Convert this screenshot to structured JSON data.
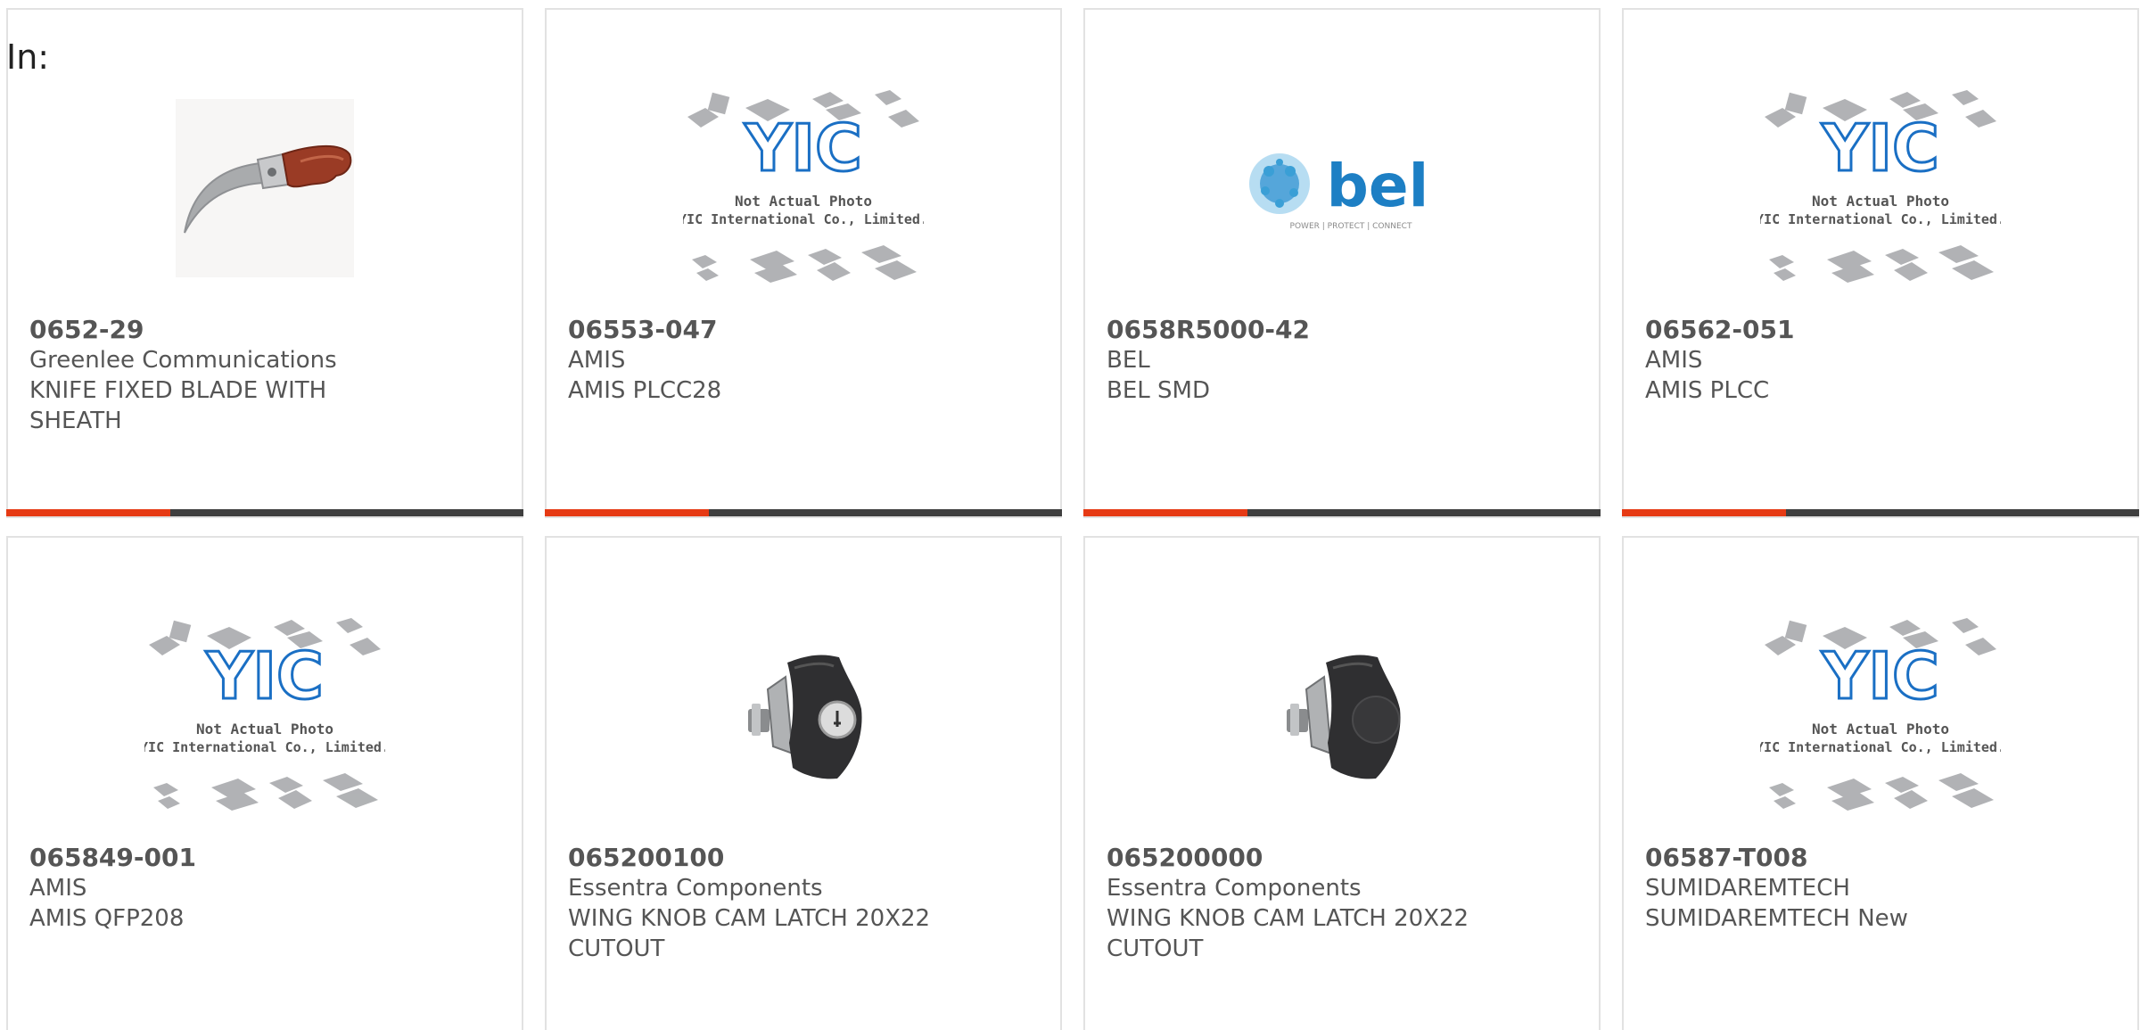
{
  "header": {
    "label": "In:"
  },
  "cards": [
    {
      "part": "0652-29",
      "maker": "Greenlee Communications",
      "description": "KNIFE FIXED BLADE WITH SHEATH",
      "image": "knife-photo",
      "image_text": ""
    },
    {
      "part": "06553-047",
      "maker": "AMIS",
      "description": "AMIS PLCC28",
      "image": "yic-placeholder",
      "image_text": "Not Actual Photo",
      "image_text_2": "YIC International Co., Limited."
    },
    {
      "part": "0658R5000-42",
      "maker": "BEL",
      "description": "BEL SMD",
      "image": "bel-logo",
      "logo_text": "bel",
      "logo_tagline": "POWER | PROTECT | CONNECT"
    },
    {
      "part": "06562-051",
      "maker": "AMIS",
      "description": "AMIS PLCC",
      "image": "yic-placeholder",
      "image_text": "Not Actual Photo",
      "image_text_2": "YIC International Co., Limited."
    },
    {
      "part": "065849-001",
      "maker": "AMIS",
      "description": "AMIS QFP208",
      "image": "yic-placeholder",
      "image_text": "Not Actual Photo",
      "image_text_2": "YIC International Co., Limited."
    },
    {
      "part": "065200100",
      "maker": "Essentra Components",
      "description": "WING KNOB CAM LATCH 20X22 CUTOUT",
      "image": "cam-latch-with-key"
    },
    {
      "part": "065200000",
      "maker": "Essentra Components",
      "description": "WING KNOB CAM LATCH 20X22 CUTOUT",
      "image": "cam-latch"
    },
    {
      "part": "06587-T008",
      "maker": "SUMIDAREMTECH",
      "description": "SUMIDAREMTECH New",
      "image": "yic-placeholder",
      "image_text": "Not Actual Photo",
      "image_text_2": "YIC International Co., Limited."
    }
  ],
  "colors": {
    "accent_red": "#e63a14",
    "accent_dark": "#3f3f3f",
    "text": "#555555",
    "yic_blue": "#1a6fc4",
    "bel_blue": "#1d7fc4"
  }
}
